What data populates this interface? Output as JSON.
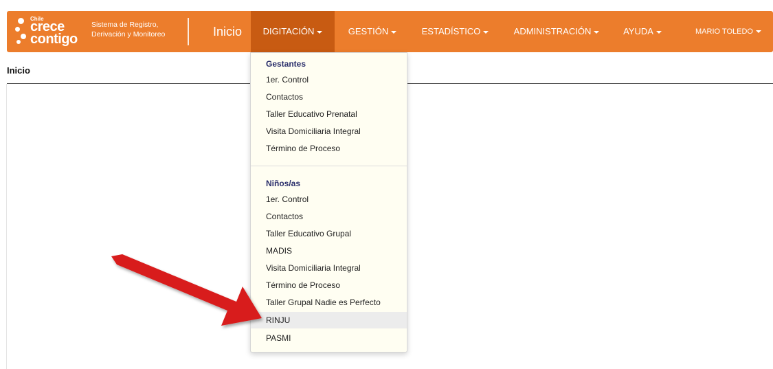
{
  "brand": {
    "logo_small": "Chile",
    "logo_line1": "crece",
    "logo_line2": "contigo",
    "system_line1": "Sistema de Registro,",
    "system_line2": "Derivación y Monitoreo"
  },
  "nav": {
    "home": "Inicio",
    "items": [
      {
        "label": "DIGITACIÓN"
      },
      {
        "label": "GESTIÓN"
      },
      {
        "label": "ESTADÍSTICO"
      },
      {
        "label": "ADMINISTRACIÓN"
      },
      {
        "label": "AYUDA"
      },
      {
        "label": "MARIO TOLEDO"
      }
    ]
  },
  "page": {
    "title": "Inicio"
  },
  "dropdown": {
    "gestantes": {
      "header": "Gestantes",
      "items": [
        "1er. Control",
        "Contactos",
        "Taller Educativo Prenatal",
        "Visita Domiciliaria Integral",
        "Término de Proceso"
      ]
    },
    "ninos": {
      "header": "Niños/as",
      "items": [
        "1er. Control",
        "Contactos",
        "Taller Educativo Grupal",
        "MADIS",
        "Visita Domiciliaria Integral",
        "Término de Proceso",
        "Taller Grupal Nadie es Perfecto",
        "RINJU",
        "PASMI"
      ]
    },
    "highlighted": "RINJU"
  },
  "colors": {
    "navbar": "#ec7d2c",
    "navbar_active": "#c85b12",
    "dropdown_header": "#2a2e6b",
    "arrow": "#d81e1e"
  }
}
